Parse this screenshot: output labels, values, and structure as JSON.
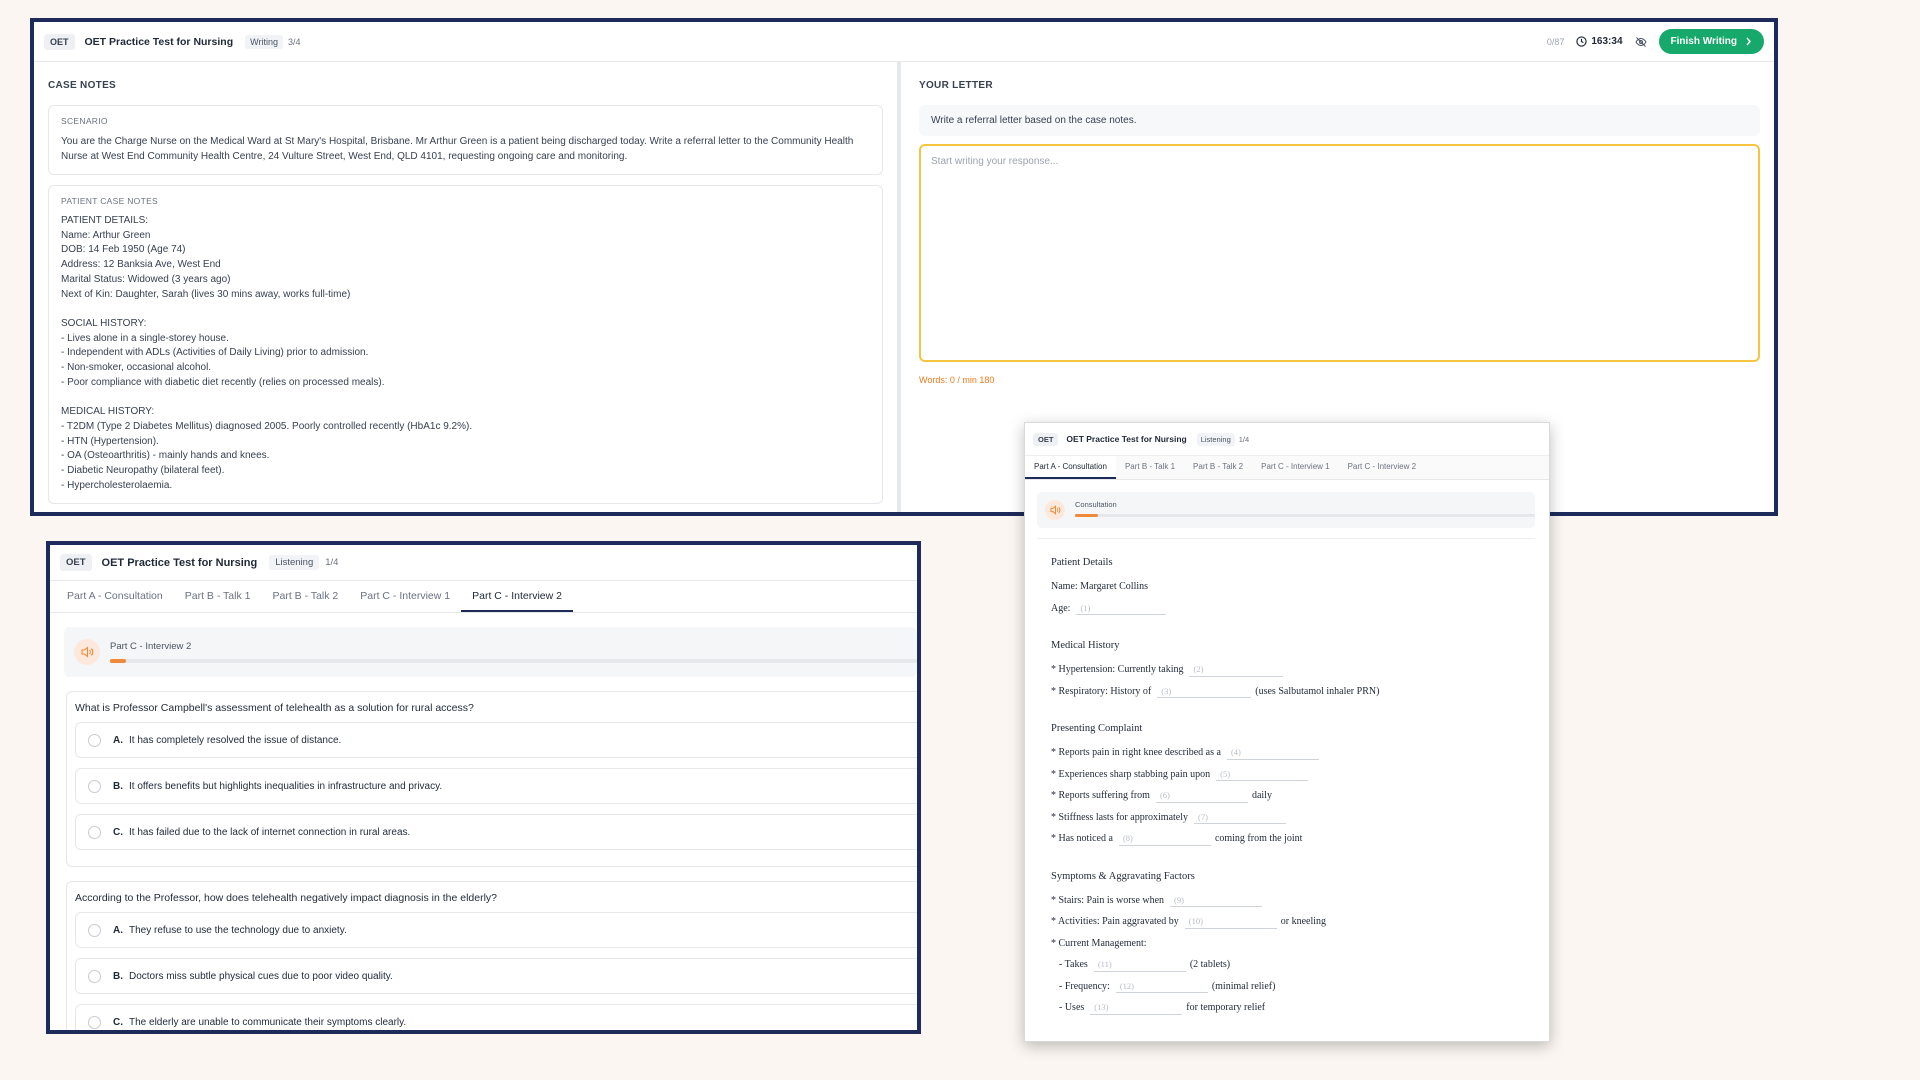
{
  "writing": {
    "header": {
      "badge": "OET",
      "title": "OET Practice Test for Nursing",
      "mode": "Writing",
      "progress": "3/4",
      "word_counter": "0/87",
      "timer": "163:34",
      "finish_label": "Finish Writing"
    },
    "case_notes": {
      "title": "CASE NOTES",
      "scenario_label": "SCENARIO",
      "scenario_text": "You are the Charge Nurse on the Medical Ward at St Mary's Hospital, Brisbane. Mr Arthur Green is a patient being discharged today. Write a referral letter to the Community Health Nurse at West End Community Health Centre, 24 Vulture Street, West End, QLD 4101, requesting ongoing care and monitoring.",
      "patient_label": "PATIENT CASE NOTES",
      "lines": [
        "PATIENT DETAILS:",
        "Name: Arthur Green",
        "DOB: 14 Feb 1950 (Age 74)",
        "Address: 12 Banksia Ave, West End",
        "Marital Status: Widowed (3 years ago)",
        "Next of Kin: Daughter, Sarah (lives 30 mins away, works full-time)",
        "",
        "SOCIAL HISTORY:",
        "- Lives alone in a single-storey house.",
        "- Independent with ADLs (Activities of Daily Living) prior to admission.",
        "- Non-smoker, occasional alcohol.",
        "- Poor compliance with diabetic diet recently (relies on processed meals).",
        "",
        "MEDICAL HISTORY:",
        "- T2DM (Type 2 Diabetes Mellitus) diagnosed 2005. Poorly controlled recently (HbA1c 9.2%).",
        "- HTN (Hypertension).",
        "- OA (Osteoarthritis) - mainly hands and knees.",
        "- Diabetic Neuropathy (bilateral feet).",
        "- Hypercholesterolaemia."
      ]
    },
    "letter": {
      "title": "YOUR LETTER",
      "prompt": "Write a referral letter based on the case notes.",
      "placeholder": "Start writing your response...",
      "words": "Words: 0 / min 180"
    }
  },
  "listening_c": {
    "header": {
      "badge": "OET",
      "title": "OET Practice Test for Nursing",
      "mode": "Listening",
      "progress": "1/4"
    },
    "tabs": [
      "Part A - Consultation",
      "Part B - Talk 1",
      "Part B - Talk 2",
      "Part C - Interview 1",
      "Part C - Interview 2"
    ],
    "active_tab": 4,
    "audio": {
      "label": "Part C - Interview 2",
      "progress": 0.02
    },
    "questions": [
      {
        "text": "What is Professor Campbell's assessment of telehealth as a solution for rural access?",
        "options": [
          {
            "letter": "A.",
            "text": "It has completely resolved the issue of distance."
          },
          {
            "letter": "B.",
            "text": "It offers benefits but highlights inequalities in infrastructure and privacy."
          },
          {
            "letter": "C.",
            "text": "It has failed due to the lack of internet connection in rural areas."
          }
        ]
      },
      {
        "text": "According to the Professor, how does telehealth negatively impact diagnosis in the elderly?",
        "options": [
          {
            "letter": "A.",
            "text": "They refuse to use the technology due to anxiety."
          },
          {
            "letter": "B.",
            "text": "Doctors miss subtle physical cues due to poor video quality."
          },
          {
            "letter": "C.",
            "text": "The elderly are unable to communicate their symptoms clearly."
          }
        ]
      }
    ]
  },
  "listening_a": {
    "header": {
      "badge": "OET",
      "title": "OET Practice Test for Nursing",
      "mode": "Listening",
      "progress": "1/4"
    },
    "tabs": [
      "Part A - Consultation",
      "Part B - Talk 1",
      "Part B - Talk 2",
      "Part C - Interview 1",
      "Part C - Interview 2"
    ],
    "active_tab": 0,
    "audio": {
      "label": "Consultation",
      "progress": 0.05
    },
    "form": {
      "patient_details": "Patient Details",
      "name_line": "Name: Margaret Collins",
      "age_prefix": "Age:",
      "age_blank": "(1)",
      "medical_history": "Medical History",
      "hyp_prefix": "* Hypertension: Currently taking",
      "hyp_blank": "(2)",
      "resp_prefix": "* Respiratory: History of",
      "resp_blank": "(3)",
      "resp_suffix": "(uses Salbutamol inhaler PRN)",
      "presenting": "Presenting Complaint",
      "pc1_prefix": "* Reports pain in right knee described as a",
      "pc1_blank": "(4)",
      "pc2_prefix": "* Experiences sharp stabbing pain upon",
      "pc2_blank": "(5)",
      "pc3_prefix": "* Reports suffering from",
      "pc3_blank": "(6)",
      "pc3_suffix": "daily",
      "pc4_prefix": "* Stiffness lasts for approximately",
      "pc4_blank": "(7)",
      "pc5_prefix": "* Has noticed a",
      "pc5_blank": "(8)",
      "pc5_suffix": "coming from the joint",
      "symptoms": "Symptoms & Aggravating Factors",
      "s1_prefix": "* Stairs: Pain is worse when",
      "s1_blank": "(9)",
      "s2_prefix": "* Activities: Pain aggravated by",
      "s2_blank": "(10)",
      "s2_suffix": "or kneeling",
      "s3": "* Current Management:",
      "m1_prefix": "- Takes",
      "m1_blank": "(11)",
      "m1_suffix": "(2 tablets)",
      "m2_prefix": "- Frequency:",
      "m2_blank": "(12)",
      "m2_suffix": "(minimal relief)",
      "m3_prefix": "- Uses",
      "m3_blank": "(13)",
      "m3_suffix": "for temporary relief"
    }
  }
}
